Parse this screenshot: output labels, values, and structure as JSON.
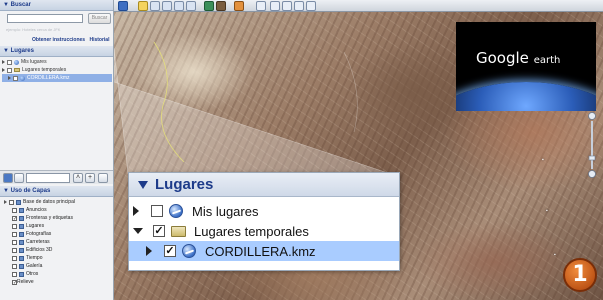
{
  "sidebar": {
    "search": {
      "title": "Buscar",
      "input_value": "",
      "button_label": "Buscar",
      "hint": "ejemplo: Hoteles cerca de JFK",
      "links": [
        "Obtener instrucciones",
        "Historial"
      ]
    },
    "places": {
      "title": "Lugares",
      "items": [
        {
          "label": "Mis lugares",
          "icon": "globe-icon"
        },
        {
          "label": "Lugares temporales",
          "icon": "folder-icon"
        },
        {
          "label": "CORDILLERA.kmz",
          "icon": "globe-icon",
          "selected": true
        }
      ]
    },
    "layers": {
      "title": "Capas",
      "title_prefix": "Uso de",
      "root": "Base de datos principal",
      "items": [
        "Anuncios",
        "Fronteras y etiquetas",
        "Lugares",
        "Fotografías",
        "Carreteras",
        "Edificios 3D",
        "Tiempo",
        "Galería",
        "Otros",
        "Relieve"
      ]
    }
  },
  "logo": {
    "brand": "Google",
    "suffix": "earth"
  },
  "zoom_panel": {
    "title": "Lugares",
    "items": [
      {
        "label": "Mis lugares",
        "checked": false,
        "icon": "globe-icon"
      },
      {
        "label": "Lugares temporales",
        "checked": true,
        "icon": "folder-icon"
      },
      {
        "label": "CORDILLERA.kmz",
        "checked": true,
        "icon": "globe-icon",
        "selected": true
      }
    ]
  },
  "badge": {
    "number": "1"
  },
  "colors": {
    "accent": "#1d3b8a",
    "selection": "#a9ccff",
    "badge": "#d8671f"
  }
}
